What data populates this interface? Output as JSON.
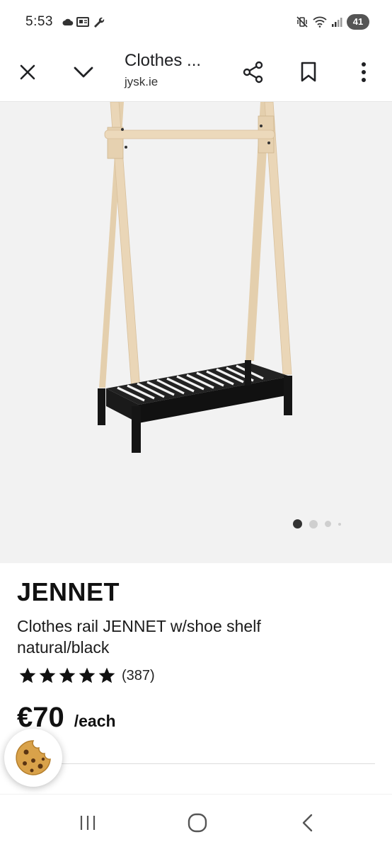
{
  "status_bar": {
    "time": "5:53",
    "battery": "41",
    "icons_left": [
      "cloud-icon",
      "news-icon",
      "wrench-icon"
    ],
    "icons_right": [
      "mute-vibrate-icon",
      "wifi-icon",
      "signal-icon",
      "battery-icon"
    ]
  },
  "app_bar": {
    "title": "Clothes ...",
    "domain": "jysk.ie",
    "icons": [
      "close-icon",
      "chevron-down-icon",
      "share-icon",
      "bookmark-icon",
      "more-vert-icon"
    ]
  },
  "product": {
    "brand": "JENNET",
    "description": "Clothes rail JENNET w/shoe shelf natural/black",
    "rating_stars": 5,
    "review_count": "(387)",
    "price": "€70",
    "unit": "/each",
    "carousel": {
      "total": 4,
      "active": 1
    }
  },
  "colors": {
    "wood": "#e8d3b2",
    "shelf_black": "#1a1a1a",
    "image_bg": "#f2f2f2",
    "active_dot": "#333333",
    "inactive_dot": "#cfcfcf"
  },
  "nav_bar": {
    "icons": [
      "recents-icon",
      "home-icon",
      "back-icon"
    ]
  },
  "floating": {
    "icon": "cookie-icon"
  }
}
